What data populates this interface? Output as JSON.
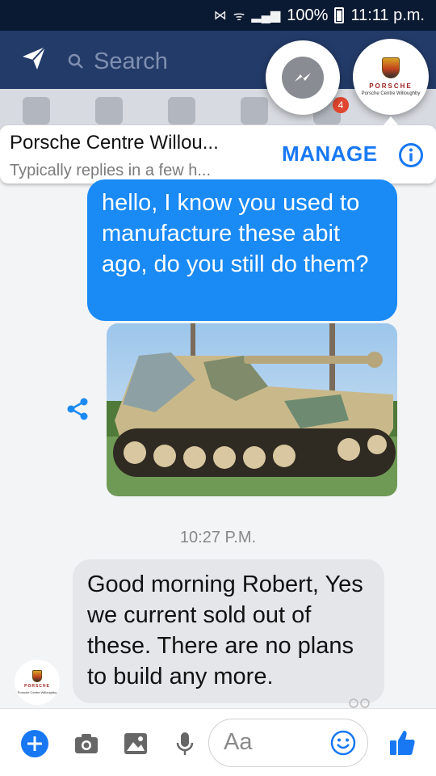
{
  "status_bar": {
    "battery": "100%",
    "time": "11:11 p.m."
  },
  "header": {
    "search_placeholder": "Search",
    "tab_badge": "4"
  },
  "chat_heads": {
    "page_logo_word": "PORSCHE",
    "page_logo_sub": "Porsche Centre Willoughby"
  },
  "conversation": {
    "name": "Porsche Centre Willou...",
    "subtitle": "Typically replies in a few h...",
    "manage_label": "MANAGE"
  },
  "messages": {
    "outgoing_text": "hello, I know you used to manufacture these abit ago, do you still do them?",
    "timestamp": "10:27 P.M.",
    "incoming_text": "Good morning Robert, Yes we current sold out of these. There are no plans to build any more."
  },
  "composer": {
    "placeholder": "Aa"
  },
  "colors": {
    "accent": "#1a8af5",
    "header": "#233b69",
    "status": "#0b1a33"
  }
}
